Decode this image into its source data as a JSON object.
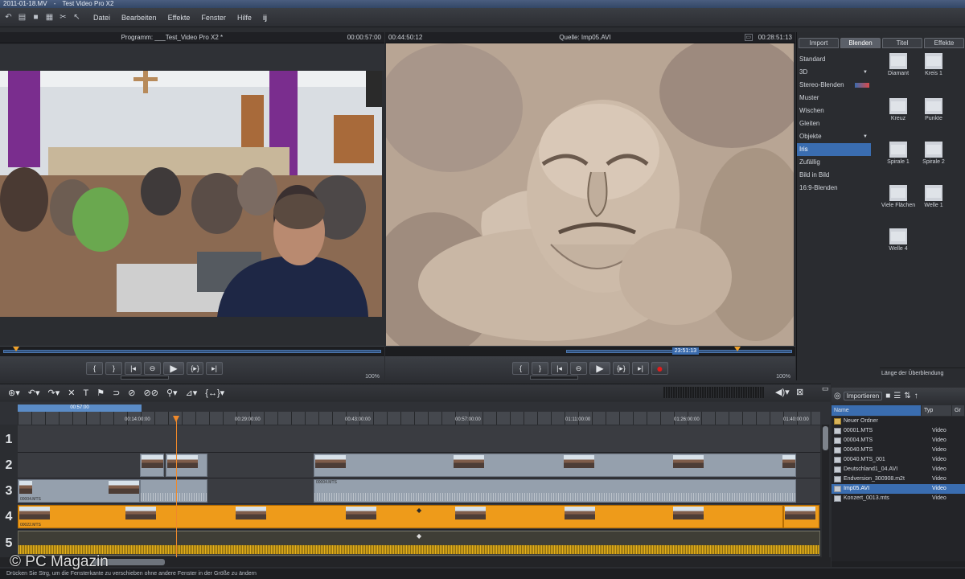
{
  "window": {
    "title_prefix": "2011-01-18.MV",
    "title": "Test Video Pro X2"
  },
  "menubar": {
    "items": [
      "Datei",
      "Bearbeiten",
      "Effekte",
      "Fenster",
      "Hilfe"
    ]
  },
  "program_monitor": {
    "title": "Programm: ___Test_Video Pro X2 *",
    "timecode": "00:00:57:00",
    "zoom": "100%"
  },
  "source_monitor": {
    "timecode_left": "00:44:50:12",
    "title": "Quelle: Imp05.AVI",
    "timecode_right": "00:28:51:13",
    "scrub_timecode": "23:51:13",
    "zoom": "100%"
  },
  "effects_panel": {
    "tabs": [
      "Import",
      "Blenden",
      "Titel",
      "Effekte"
    ],
    "active_tab": "Blenden",
    "categories": [
      {
        "label": "Standard"
      },
      {
        "label": "3D",
        "arrow": true
      },
      {
        "label": "Stereo-Blenden",
        "swatch": true
      },
      {
        "label": "Muster"
      },
      {
        "label": "Wischen"
      },
      {
        "label": "Gleiten"
      },
      {
        "label": "Objekte",
        "arrow": true
      },
      {
        "label": "Iris",
        "selected": true
      },
      {
        "label": "Zufällig"
      },
      {
        "label": "Bild in Bild"
      },
      {
        "label": "16:9-Blenden"
      }
    ],
    "transitions": [
      "Diamant",
      "Kreis 1",
      "Kreuz",
      "Punkte",
      "Spirale 1",
      "Spirale 2",
      "Viele Flächen",
      "Welle 1",
      "Welle 4"
    ],
    "footer": "Länge der Überblendung"
  },
  "timeline": {
    "loop_label": "00:57:00",
    "ruler_labels": [
      "00:14:00:00",
      "00:29:00:00",
      "00:43:00:00",
      "00:57:00:00",
      "01:11:00:00",
      "01:26:00:00",
      "01:40:00:00"
    ],
    "tracks": [
      "1",
      "2",
      "3",
      "4",
      "5"
    ],
    "clip_names": {
      "t3a": "00004.MTS",
      "t3b": "00004.MTS",
      "t4a": "00022.MTS"
    }
  },
  "media_pool": {
    "import_label": "Importieren",
    "columns": [
      "Name",
      "Typ",
      "Gr"
    ],
    "rows": [
      {
        "name": "Neuer Ordner",
        "type": "",
        "folder": true
      },
      {
        "name": "00001.MTS",
        "type": "Video"
      },
      {
        "name": "00004.MTS",
        "type": "Video"
      },
      {
        "name": "00040.MTS",
        "type": "Video"
      },
      {
        "name": "00040.MTS_001",
        "type": "Video"
      },
      {
        "name": "Deutschland1_04.AVI",
        "type": "Video"
      },
      {
        "name": "Endversion_300908.m2t",
        "type": "Video"
      },
      {
        "name": "Imp05.AVI",
        "type": "Video",
        "selected": true
      },
      {
        "name": "Konzert_0013.mts",
        "type": "Video"
      }
    ]
  },
  "statusbar": {
    "text": "Drücken Sie Strg, um die Fensterkante zu verschieben ohne andere Fenster in der Größe zu ändern"
  },
  "watermark": "© PC Magazin",
  "colors": {
    "accent": "#3a6db0",
    "audio_clip": "#ee9b1a",
    "playhead": "#f0892a",
    "record": "#e11c1c"
  }
}
